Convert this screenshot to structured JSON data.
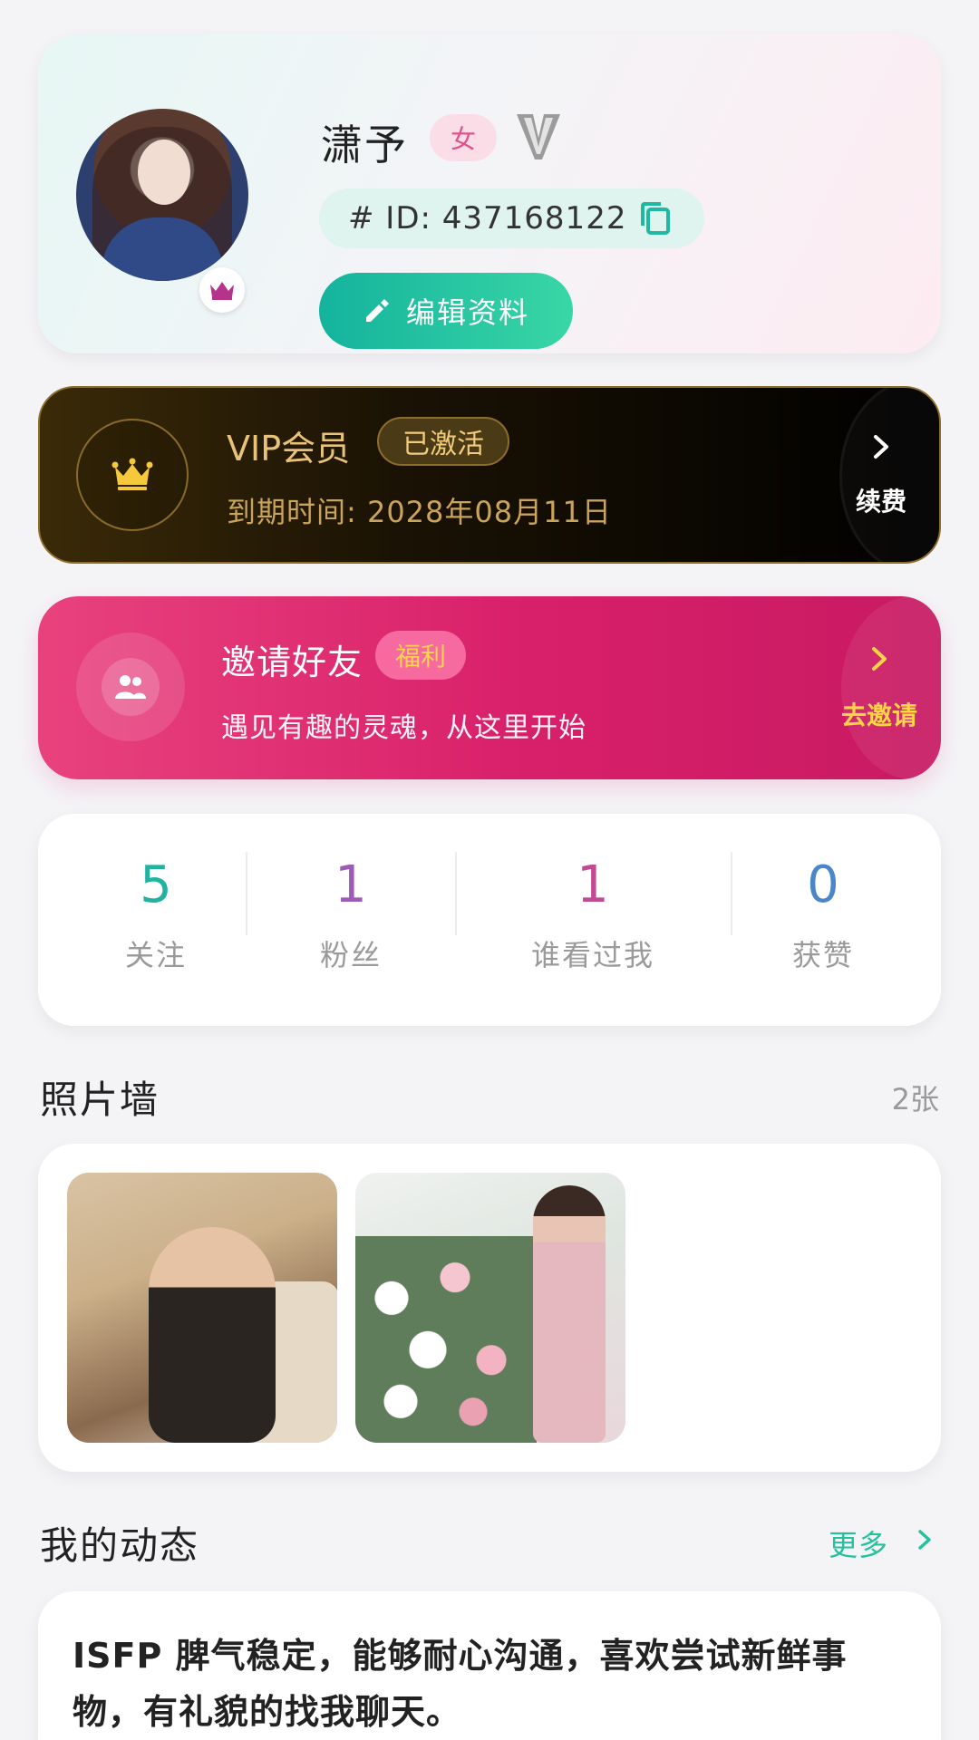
{
  "profile": {
    "name": "潇予",
    "gender": "女",
    "id_text": "# ID: 437168122",
    "edit_label": "编辑资料"
  },
  "vip": {
    "title": "VIP会员",
    "status": "已激活",
    "expire_text": "到期时间:  2028年08月11日",
    "renew_label": "续费"
  },
  "invite": {
    "title": "邀请好友",
    "tag": "福利",
    "subtitle": "遇见有趣的灵魂，从这里开始",
    "action_label": "去邀请"
  },
  "stats": [
    {
      "value": "5",
      "label": "关注",
      "color": "#1fb3a0"
    },
    {
      "value": "1",
      "label": "粉丝",
      "color": "#9b5bb7"
    },
    {
      "value": "1",
      "label": "谁看过我",
      "color": "#c04a93"
    },
    {
      "value": "0",
      "label": "获赞",
      "color": "#4a86c9"
    }
  ],
  "photo_wall": {
    "title": "照片墙",
    "count": "2张"
  },
  "moments": {
    "title": "我的动态",
    "more_label": "更多",
    "first_post": "ISFP  脾气稳定，能够耐心沟通，喜欢尝试新鲜事物，有礼貌的找我聊天。"
  },
  "colors": {
    "accent": "#1fb8a0",
    "vip_gold": "#e8c277",
    "invite_pink": "#e0336f"
  },
  "icons": [
    "crown-icon",
    "vip-v-icon",
    "copy-icon",
    "pencil-icon",
    "chevron-right-icon",
    "users-icon"
  ]
}
